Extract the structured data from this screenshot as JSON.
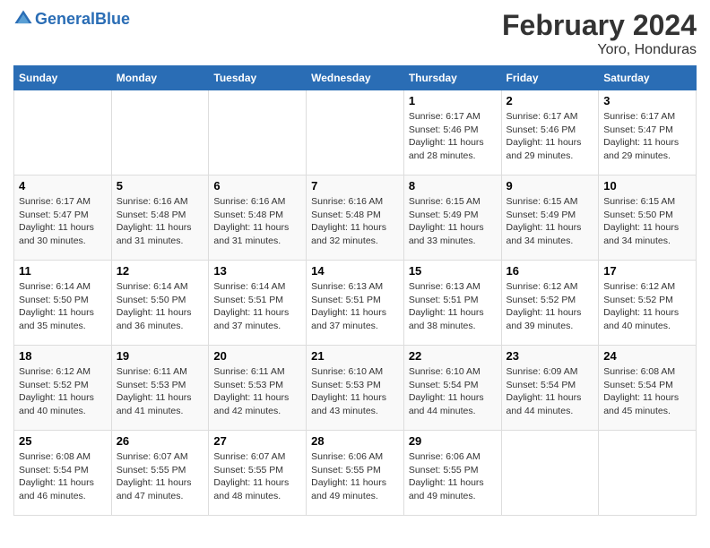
{
  "header": {
    "logo_general": "General",
    "logo_blue": "Blue",
    "title": "February 2024",
    "subtitle": "Yoro, Honduras"
  },
  "columns": [
    "Sunday",
    "Monday",
    "Tuesday",
    "Wednesday",
    "Thursday",
    "Friday",
    "Saturday"
  ],
  "weeks": [
    [
      {
        "day": "",
        "info": ""
      },
      {
        "day": "",
        "info": ""
      },
      {
        "day": "",
        "info": ""
      },
      {
        "day": "",
        "info": ""
      },
      {
        "day": "1",
        "info": "Sunrise: 6:17 AM\nSunset: 5:46 PM\nDaylight: 11 hours and 28 minutes."
      },
      {
        "day": "2",
        "info": "Sunrise: 6:17 AM\nSunset: 5:46 PM\nDaylight: 11 hours and 29 minutes."
      },
      {
        "day": "3",
        "info": "Sunrise: 6:17 AM\nSunset: 5:47 PM\nDaylight: 11 hours and 29 minutes."
      }
    ],
    [
      {
        "day": "4",
        "info": "Sunrise: 6:17 AM\nSunset: 5:47 PM\nDaylight: 11 hours and 30 minutes."
      },
      {
        "day": "5",
        "info": "Sunrise: 6:16 AM\nSunset: 5:48 PM\nDaylight: 11 hours and 31 minutes."
      },
      {
        "day": "6",
        "info": "Sunrise: 6:16 AM\nSunset: 5:48 PM\nDaylight: 11 hours and 31 minutes."
      },
      {
        "day": "7",
        "info": "Sunrise: 6:16 AM\nSunset: 5:48 PM\nDaylight: 11 hours and 32 minutes."
      },
      {
        "day": "8",
        "info": "Sunrise: 6:15 AM\nSunset: 5:49 PM\nDaylight: 11 hours and 33 minutes."
      },
      {
        "day": "9",
        "info": "Sunrise: 6:15 AM\nSunset: 5:49 PM\nDaylight: 11 hours and 34 minutes."
      },
      {
        "day": "10",
        "info": "Sunrise: 6:15 AM\nSunset: 5:50 PM\nDaylight: 11 hours and 34 minutes."
      }
    ],
    [
      {
        "day": "11",
        "info": "Sunrise: 6:14 AM\nSunset: 5:50 PM\nDaylight: 11 hours and 35 minutes."
      },
      {
        "day": "12",
        "info": "Sunrise: 6:14 AM\nSunset: 5:50 PM\nDaylight: 11 hours and 36 minutes."
      },
      {
        "day": "13",
        "info": "Sunrise: 6:14 AM\nSunset: 5:51 PM\nDaylight: 11 hours and 37 minutes."
      },
      {
        "day": "14",
        "info": "Sunrise: 6:13 AM\nSunset: 5:51 PM\nDaylight: 11 hours and 37 minutes."
      },
      {
        "day": "15",
        "info": "Sunrise: 6:13 AM\nSunset: 5:51 PM\nDaylight: 11 hours and 38 minutes."
      },
      {
        "day": "16",
        "info": "Sunrise: 6:12 AM\nSunset: 5:52 PM\nDaylight: 11 hours and 39 minutes."
      },
      {
        "day": "17",
        "info": "Sunrise: 6:12 AM\nSunset: 5:52 PM\nDaylight: 11 hours and 40 minutes."
      }
    ],
    [
      {
        "day": "18",
        "info": "Sunrise: 6:12 AM\nSunset: 5:52 PM\nDaylight: 11 hours and 40 minutes."
      },
      {
        "day": "19",
        "info": "Sunrise: 6:11 AM\nSunset: 5:53 PM\nDaylight: 11 hours and 41 minutes."
      },
      {
        "day": "20",
        "info": "Sunrise: 6:11 AM\nSunset: 5:53 PM\nDaylight: 11 hours and 42 minutes."
      },
      {
        "day": "21",
        "info": "Sunrise: 6:10 AM\nSunset: 5:53 PM\nDaylight: 11 hours and 43 minutes."
      },
      {
        "day": "22",
        "info": "Sunrise: 6:10 AM\nSunset: 5:54 PM\nDaylight: 11 hours and 44 minutes."
      },
      {
        "day": "23",
        "info": "Sunrise: 6:09 AM\nSunset: 5:54 PM\nDaylight: 11 hours and 44 minutes."
      },
      {
        "day": "24",
        "info": "Sunrise: 6:08 AM\nSunset: 5:54 PM\nDaylight: 11 hours and 45 minutes."
      }
    ],
    [
      {
        "day": "25",
        "info": "Sunrise: 6:08 AM\nSunset: 5:54 PM\nDaylight: 11 hours and 46 minutes."
      },
      {
        "day": "26",
        "info": "Sunrise: 6:07 AM\nSunset: 5:55 PM\nDaylight: 11 hours and 47 minutes."
      },
      {
        "day": "27",
        "info": "Sunrise: 6:07 AM\nSunset: 5:55 PM\nDaylight: 11 hours and 48 minutes."
      },
      {
        "day": "28",
        "info": "Sunrise: 6:06 AM\nSunset: 5:55 PM\nDaylight: 11 hours and 49 minutes."
      },
      {
        "day": "29",
        "info": "Sunrise: 6:06 AM\nSunset: 5:55 PM\nDaylight: 11 hours and 49 minutes."
      },
      {
        "day": "",
        "info": ""
      },
      {
        "day": "",
        "info": ""
      }
    ]
  ]
}
